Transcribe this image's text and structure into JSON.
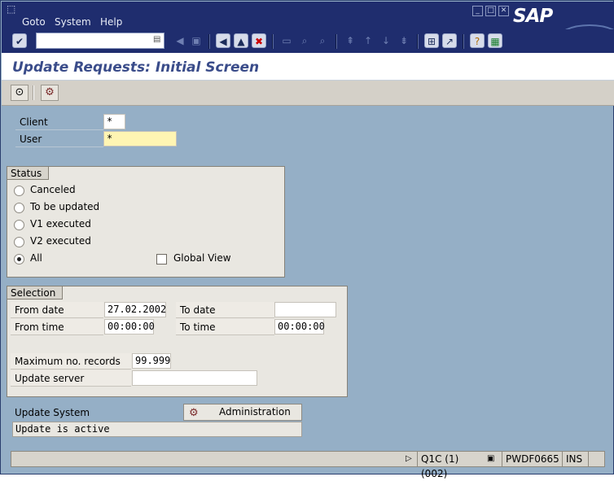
{
  "menu": {
    "items": [
      {
        "label": "Goto"
      },
      {
        "label": "System"
      },
      {
        "label": "Help"
      }
    ]
  },
  "window_controls": [
    "minimize",
    "maximize",
    "close"
  ],
  "logo": {
    "text": "SAP"
  },
  "toolbar": {
    "command_field_value": "",
    "icons": [
      "enter-icon",
      "back-icon",
      "exit-icon",
      "cancel-icon",
      "print-icon",
      "find-icon",
      "find-next-icon",
      "first-page-icon",
      "previous-page-icon",
      "next-page-icon",
      "last-page-icon",
      "create-session-icon",
      "shortcut-icon",
      "help-icon",
      "layout-icon"
    ]
  },
  "title": {
    "text": "Update Requests: Initial Screen"
  },
  "app_toolbar": {
    "icons": [
      "execute-icon",
      "settings-icon"
    ]
  },
  "selection_top": {
    "client": {
      "label": "Client",
      "value": "*"
    },
    "user": {
      "label": "User",
      "value": "*"
    }
  },
  "status_group": {
    "title": "Status",
    "options": [
      {
        "label": "Canceled",
        "selected": false
      },
      {
        "label": "To be updated",
        "selected": false
      },
      {
        "label": "V1 executed",
        "selected": false
      },
      {
        "label": "V2 executed",
        "selected": false
      },
      {
        "label": "All",
        "selected": true
      }
    ],
    "global_view": {
      "label": "Global View",
      "checked": false
    }
  },
  "selection_group": {
    "title": "Selection",
    "from_date": {
      "label": "From date",
      "value": "27.02.2002"
    },
    "to_date": {
      "label": "To date",
      "value": ""
    },
    "from_time": {
      "label": "From time",
      "value": "00:00:00"
    },
    "to_time": {
      "label": "To time",
      "value": "00:00:00"
    },
    "max_records": {
      "label": "Maximum no. records",
      "value": "99.999"
    },
    "update_server": {
      "label": "Update server",
      "value": ""
    }
  },
  "update_system": {
    "label": "Update System",
    "admin_button": "Administration",
    "status_text": "Update is active"
  },
  "statusbar": {
    "system": "Q1C (1) (002)",
    "server": "PWDF0665",
    "mode": "INS"
  },
  "colors": {
    "menubar": "#1f2d6e",
    "background": "#95afc6",
    "title_text": "#3a4c8a",
    "required_field": "#fff5b3"
  }
}
